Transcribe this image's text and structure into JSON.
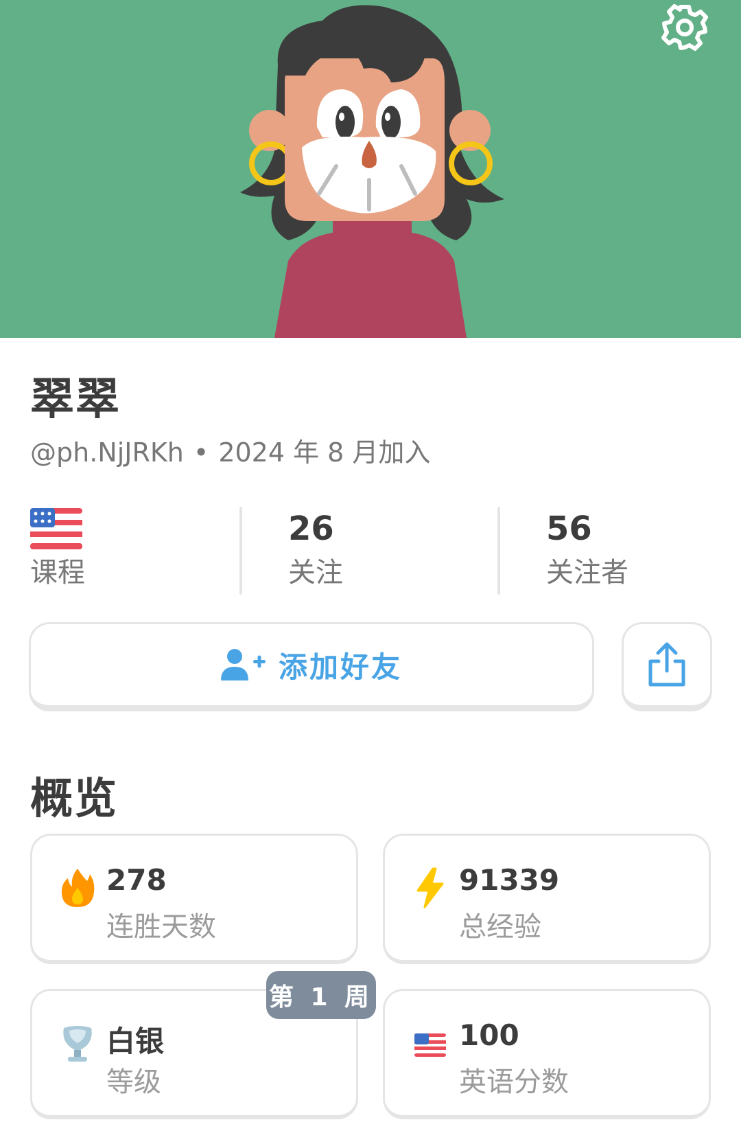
{
  "profile": {
    "name": "翠翠",
    "username": "@ph.NjJRKh",
    "separator": "•",
    "joined": "2024 年 8 月加入"
  },
  "stats": {
    "course_label": "课程",
    "following_count": "26",
    "following_label": "关注",
    "followers_count": "56",
    "followers_label": "关注者"
  },
  "actions": {
    "add_friend_label": "添加好友"
  },
  "overview": {
    "title": "概览",
    "streak_value": "278",
    "streak_label": "连胜天数",
    "xp_value": "91339",
    "xp_label": "总经验",
    "league_value": "白银",
    "league_label": "等级",
    "league_badge": "第 1 周",
    "score_value": "100",
    "score_label": "英语分数"
  },
  "icons": {
    "settings": "gear-icon",
    "course": "us-flag-icon",
    "add_friend": "add-user-icon",
    "share": "share-icon",
    "streak": "flame-icon",
    "xp": "lightning-icon",
    "league": "silver-trophy-icon",
    "score": "us-flag-icon"
  },
  "colors": {
    "header_bg": "#62b088",
    "accent_blue": "#49a4e6",
    "badge_bg": "#7f8c9c",
    "shirt": "#b0445f",
    "skin": "#e8a384",
    "hair": "#3c3c3c"
  }
}
